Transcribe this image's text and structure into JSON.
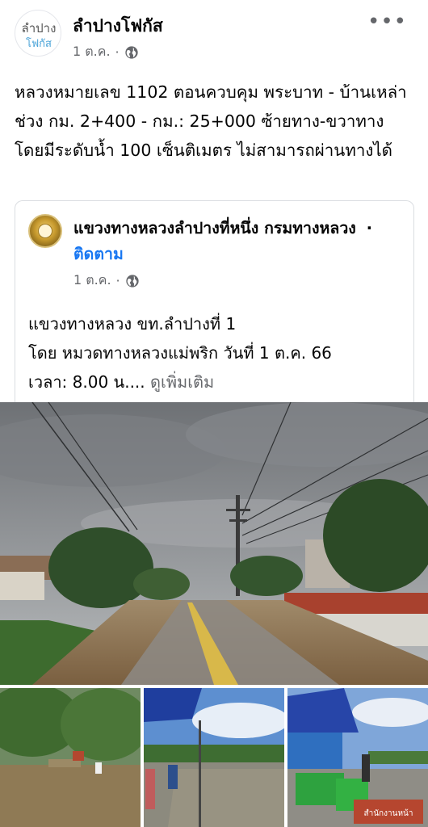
{
  "post": {
    "page_name": "ลำปางโฟกัส",
    "avatar_line1": "ลำปาง",
    "avatar_line2": "โฟกัส",
    "date": "1 ต.ค.",
    "separator": "·",
    "more_label": "•••",
    "text": "หลวงหมายเลข 1102 ตอนควบคุม พระบาท - บ้านเหล่า ช่วง กม. 2+400 - กม.: 25+000 ซ้ายทาง-ขวาทาง โดยมีระดับน้ำ 100 เซ็นติเมตร ไม่สามารถผ่านทางได้"
  },
  "shared": {
    "page_name": "แขวงทางหลวงลำปางที่หนึ่ง กรมทางหลวง",
    "dot": "·",
    "follow_label": "ติดตาม",
    "date": "1 ต.ค.",
    "separator": "·",
    "line1": "แขวงทางหลวง ขท.ลำปางที่ 1",
    "line2": "โดย หมวดทางหลวงแม่พริก วันที่ 1 ต.ค. 66",
    "line3": "เวลา: 8.00 น....",
    "see_more": "ดูเพิ่มเติม"
  },
  "photos": {
    "sign_text": "สำนักงานหน้า"
  },
  "colors": {
    "link": "#1877f2",
    "meta": "#65676b",
    "text": "#050505"
  }
}
